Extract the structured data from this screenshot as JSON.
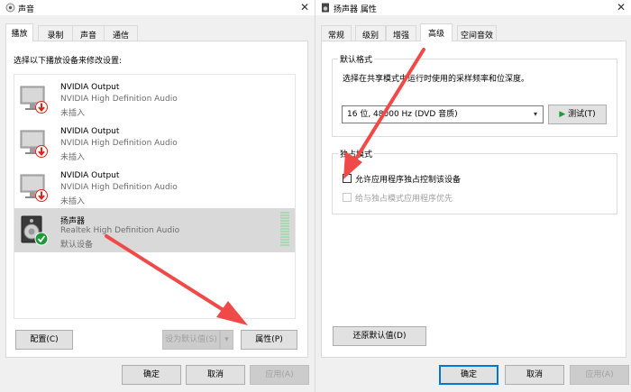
{
  "sound_window": {
    "title": "声音",
    "tabs": [
      "播放",
      "录制",
      "声音",
      "通信"
    ],
    "instruction": "选择以下播放设备来修改设置:",
    "devices": [
      {
        "name": "NVIDIA Output",
        "driver": "NVIDIA High Definition Audio",
        "status": "未插入",
        "icon": "monitor-icon",
        "badge": "unplugged-arrow-badge"
      },
      {
        "name": "NVIDIA Output",
        "driver": "NVIDIA High Definition Audio",
        "status": "未插入",
        "icon": "monitor-icon",
        "badge": "unplugged-arrow-badge"
      },
      {
        "name": "NVIDIA Output",
        "driver": "NVIDIA High Definition Audio",
        "status": "未插入",
        "icon": "monitor-icon",
        "badge": "unplugged-arrow-badge"
      },
      {
        "name": "扬声器",
        "driver": "Realtek High Definition Audio",
        "status": "默认设备",
        "icon": "speaker-icon",
        "badge": "default-check-badge"
      }
    ],
    "buttons": {
      "configure": "配置(C)",
      "set_default": "设为默认值(S)",
      "properties": "属性(P)",
      "ok": "确定",
      "cancel": "取消",
      "apply": "应用(A)"
    }
  },
  "props_window": {
    "title": "扬声器 属性",
    "tabs": [
      "常规",
      "级别",
      "增强",
      "高级",
      "空间音效"
    ],
    "default_format": {
      "title": "默认格式",
      "description": "选择在共享模式中运行时使用的采样频率和位深度。",
      "selected": "16 位, 48000 Hz (DVD 音质)",
      "test_button": "测试(T)"
    },
    "exclusive_mode": {
      "title": "独占模式",
      "allow_exclusive": "允许应用程序独占控制该设备",
      "give_priority": "给与独占模式应用程序优先"
    },
    "buttons": {
      "restore": "还原默认值(D)",
      "ok": "确定",
      "cancel": "取消",
      "apply": "应用(A)"
    }
  },
  "colors": {
    "annotation_arrow": "#f04a48",
    "accent": "#0078d7",
    "default_badge": "#1e9a3c",
    "unplugged_badge": "#d9241c"
  }
}
